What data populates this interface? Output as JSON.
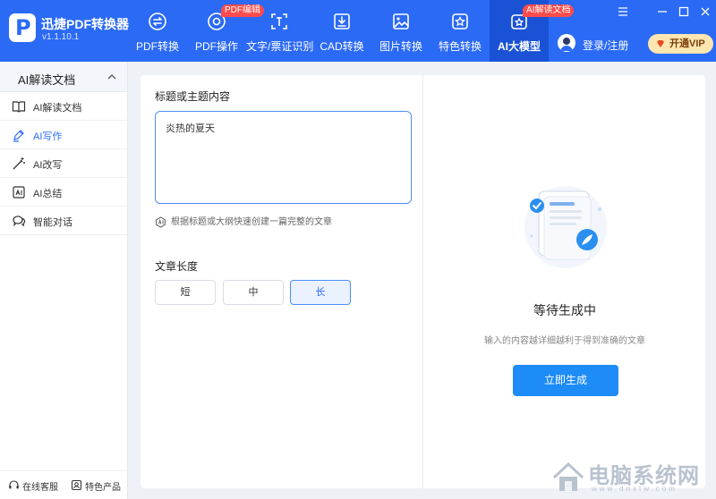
{
  "app": {
    "name": "迅捷PDF转换器",
    "version": "v1.1.10.1",
    "logo_letter": "P"
  },
  "nav": [
    {
      "label": "PDF转换",
      "icon": "convert-icon"
    },
    {
      "label": "PDF操作",
      "icon": "pdf-operate-icon",
      "badge": "PDF编辑"
    },
    {
      "label": "文字/票证识别",
      "icon": "ocr-icon"
    },
    {
      "label": "CAD转换",
      "icon": "cad-icon"
    },
    {
      "label": "图片转换",
      "icon": "image-icon"
    },
    {
      "label": "特色转换",
      "icon": "star-icon"
    },
    {
      "label": "AI大模型",
      "icon": "ai-icon",
      "badge": "AI解读文档",
      "active": true
    }
  ],
  "user": {
    "login_label": "登录/注册",
    "vip_label": "开通VIP"
  },
  "sidebar": {
    "header": "AI解读文档",
    "items": [
      {
        "label": "AI解读文档",
        "icon": "book-icon"
      },
      {
        "label": "AI写作",
        "icon": "pen-icon",
        "active": true
      },
      {
        "label": "AI改写",
        "icon": "wand-icon"
      },
      {
        "label": "AI总结",
        "icon": "summary-icon"
      },
      {
        "label": "智能对话",
        "icon": "chat-icon"
      }
    ],
    "footer": {
      "service": "在线客服",
      "featured": "特色产品"
    }
  },
  "form": {
    "title_label": "标题或主题内容",
    "title_value": "炎热的夏天",
    "hint": "根据标题或大纲快速创建一篇完整的文章",
    "length_label": "文章长度",
    "length_options": [
      "短",
      "中",
      "长"
    ],
    "length_selected": "长"
  },
  "result": {
    "status": "等待生成中",
    "tip": "输入的内容越详细越利于得到准确的文章",
    "generate_label": "立即生成"
  },
  "watermark": {
    "text": "电脑系统网",
    "sub": "www.dnxtw.com"
  },
  "colors": {
    "primary": "#2b6af5",
    "button": "#1e8cf7",
    "badge": "#ff4b4b",
    "vip": "#fde6b0"
  }
}
